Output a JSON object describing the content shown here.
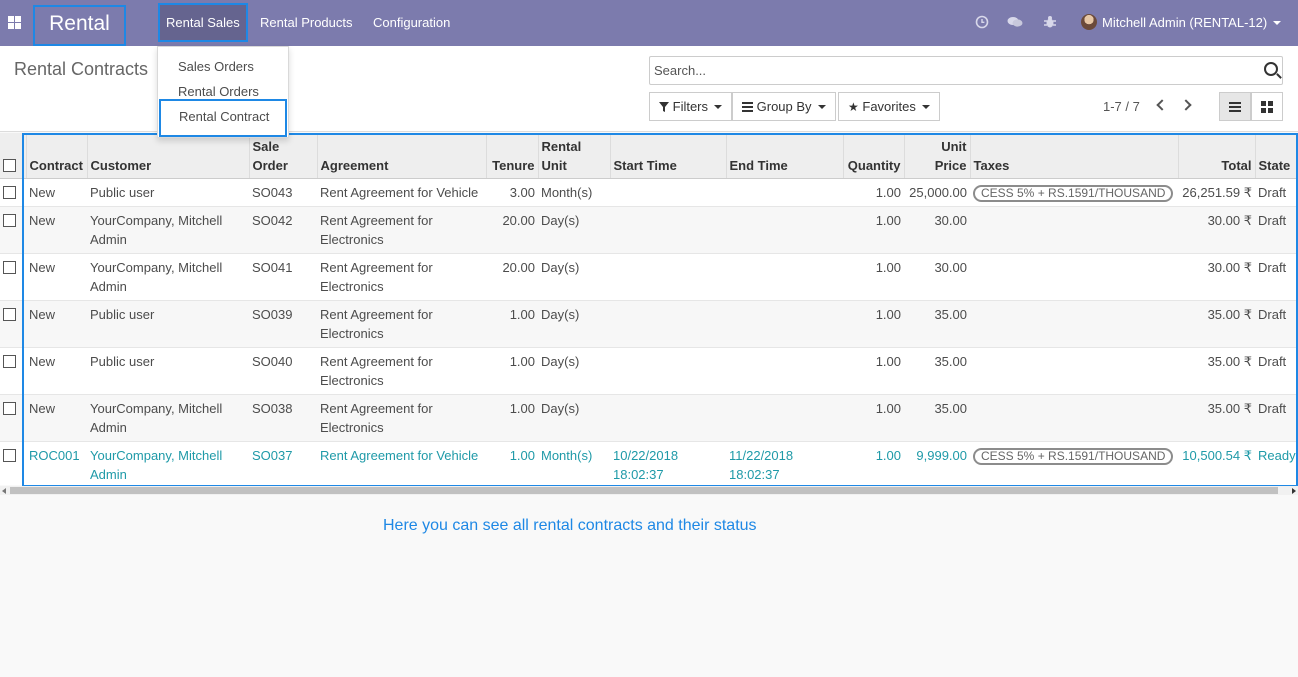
{
  "navbar": {
    "brand": "Rental",
    "menus": [
      "Rental Sales",
      "Rental Products",
      "Configuration"
    ],
    "user": "Mitchell Admin (RENTAL-12)"
  },
  "dropdown": {
    "items": [
      "Sales Orders",
      "Rental Orders",
      "Rental Contract"
    ]
  },
  "control_panel": {
    "title": "Rental Contracts",
    "search_placeholder": "Search...",
    "filters_label": "Filters",
    "groupby_label": "Group By",
    "favorites_label": "Favorites",
    "pager": "1-7 / 7"
  },
  "table": {
    "headers": {
      "contract": "Contract",
      "customer": "Customer",
      "sale_order_1": "Sale",
      "sale_order_2": "Order",
      "agreement": "Agreement",
      "tenure": "Tenure",
      "rental_unit_1": "Rental",
      "rental_unit_2": "Unit",
      "start_time": "Start Time",
      "end_time": "End Time",
      "quantity": "Quantity",
      "unit_price_1": "Unit",
      "unit_price_2": "Price",
      "taxes": "Taxes",
      "total": "Total",
      "state": "State"
    },
    "rows": [
      {
        "contract": "New",
        "customer": "Public user",
        "order": "SO043",
        "agreement": "Rent Agreement for Vehicle",
        "tenure": "3.00",
        "unit": "Month(s)",
        "start": "",
        "end": "",
        "qty": "1.00",
        "price": "25,000.00",
        "tax": "CESS 5% + RS.1591/THOUSAND",
        "total": "26,251.59 ₹",
        "state": "Draft"
      },
      {
        "contract": "New",
        "customer": "YourCompany, Mitchell Admin",
        "order": "SO042",
        "agreement": "Rent Agreement for Electronics",
        "tenure": "20.00",
        "unit": "Day(s)",
        "start": "",
        "end": "",
        "qty": "1.00",
        "price": "30.00",
        "tax": "",
        "total": "30.00 ₹",
        "state": "Draft"
      },
      {
        "contract": "New",
        "customer": "YourCompany, Mitchell Admin",
        "order": "SO041",
        "agreement": "Rent Agreement for Electronics",
        "tenure": "20.00",
        "unit": "Day(s)",
        "start": "",
        "end": "",
        "qty": "1.00",
        "price": "30.00",
        "tax": "",
        "total": "30.00 ₹",
        "state": "Draft"
      },
      {
        "contract": "New",
        "customer": "Public user",
        "order": "SO039",
        "agreement": "Rent Agreement for Electronics",
        "tenure": "1.00",
        "unit": "Day(s)",
        "start": "",
        "end": "",
        "qty": "1.00",
        "price": "35.00",
        "tax": "",
        "total": "35.00 ₹",
        "state": "Draft"
      },
      {
        "contract": "New",
        "customer": "Public user",
        "order": "SO040",
        "agreement": "Rent Agreement for Electronics",
        "tenure": "1.00",
        "unit": "Day(s)",
        "start": "",
        "end": "",
        "qty": "1.00",
        "price": "35.00",
        "tax": "",
        "total": "35.00 ₹",
        "state": "Draft"
      },
      {
        "contract": "New",
        "customer": "YourCompany, Mitchell Admin",
        "order": "SO038",
        "agreement": "Rent Agreement for Electronics",
        "tenure": "1.00",
        "unit": "Day(s)",
        "start": "",
        "end": "",
        "qty": "1.00",
        "price": "35.00",
        "tax": "",
        "total": "35.00 ₹",
        "state": "Draft"
      },
      {
        "contract": "ROC001",
        "customer": "YourCompany, Mitchell Admin",
        "order": "SO037",
        "agreement": "Rent Agreement for Vehicle",
        "tenure": "1.00",
        "unit": "Month(s)",
        "start": "10/22/2018 18:02:37",
        "end": "11/22/2018 18:02:37",
        "qty": "1.00",
        "price": "9,999.00",
        "tax": "CESS 5% + RS.1591/THOUSAND",
        "total": "10,500.54 ₹",
        "state": "Ready"
      }
    ]
  },
  "caption": "Here you can see all rental contracts and their status",
  "colors": {
    "navbar": "#7c7bad",
    "highlight": "#1e88e5",
    "ready_row": "#1f9aa8"
  }
}
